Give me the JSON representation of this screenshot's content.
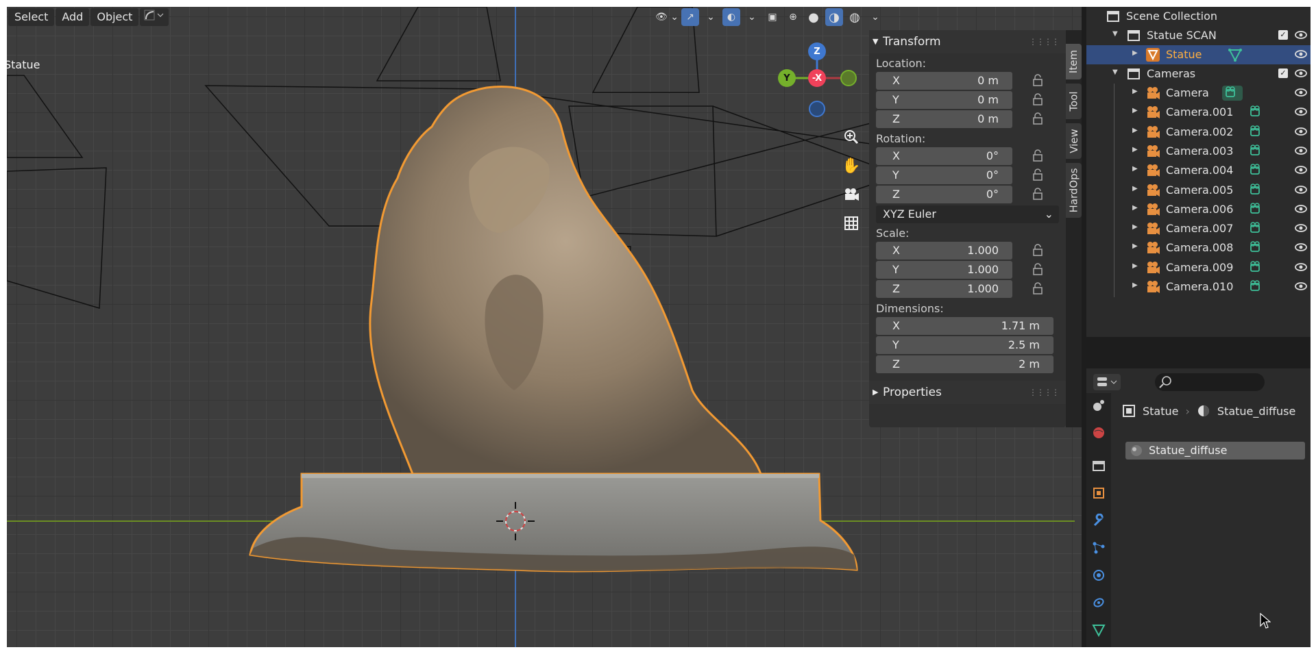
{
  "viewport": {
    "menu": {
      "select": "Select",
      "add": "Add",
      "object": "Object"
    },
    "object_label": "Statue"
  },
  "gizmo": {
    "z": "Z",
    "y": "Y",
    "neg_x": "-X"
  },
  "n_panel": {
    "transform_title": "Transform",
    "location_label": "Location:",
    "location": {
      "x": "0 m",
      "y": "0 m",
      "z": "0 m"
    },
    "rotation_label": "Rotation:",
    "rotation": {
      "x": "0°",
      "y": "0°",
      "z": "0°"
    },
    "rotation_mode": "XYZ Euler",
    "scale_label": "Scale:",
    "scale": {
      "x": "1.000",
      "y": "1.000",
      "z": "1.000"
    },
    "dimensions_label": "Dimensions:",
    "dimensions": {
      "x": "1.71 m",
      "y": "2.5 m",
      "z": "2 m"
    },
    "axis": {
      "x": "X",
      "y": "Y",
      "z": "Z"
    },
    "properties_title": "Properties",
    "tabs": {
      "item": "Item",
      "tool": "Tool",
      "view": "View",
      "hardops": "HardOps"
    }
  },
  "outliner": {
    "scene_collection": "Scene Collection",
    "statue_scan": "Statue SCAN",
    "statue": "Statue",
    "cameras": "Cameras",
    "camera_items": [
      "Camera",
      "Camera.001",
      "Camera.002",
      "Camera.003",
      "Camera.004",
      "Camera.005",
      "Camera.006",
      "Camera.007",
      "Camera.008",
      "Camera.009",
      "Camera.010"
    ]
  },
  "properties": {
    "breadcrumb_object": "Statue",
    "breadcrumb_material": "Statue_diffuse",
    "material_slot": "Statue_diffuse"
  },
  "colors": {
    "selection_orange": "#f29a33",
    "active_blue": "#4772b3",
    "outliner_selected": "#334d80",
    "data_green": "#3ec19a",
    "camera_orange": "#e89040"
  }
}
